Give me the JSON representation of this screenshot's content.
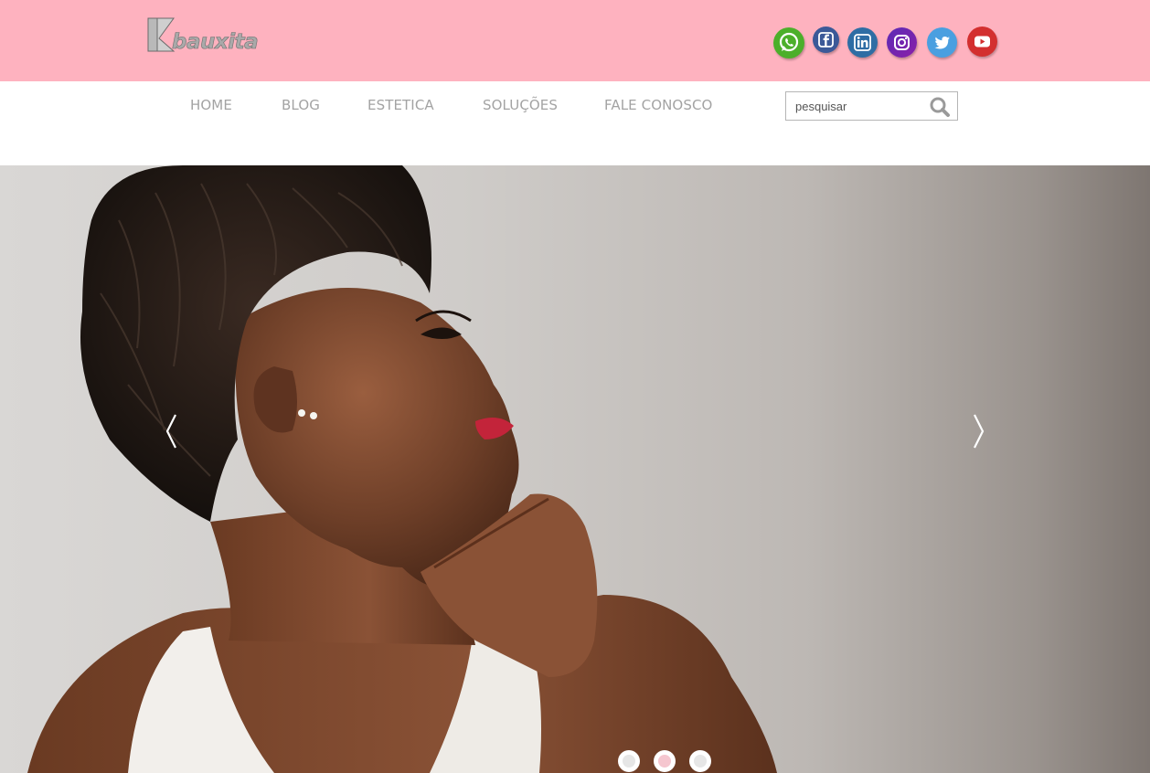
{
  "header": {
    "logo_text": "bauxita",
    "social": [
      {
        "icon": "whatsapp-icon",
        "color": "#4caf2a"
      },
      {
        "icon": "facebook-icon",
        "color": "#3b5998"
      },
      {
        "icon": "linkedin-icon",
        "color": "#2e6da4"
      },
      {
        "icon": "instagram-icon",
        "color": "#7b1fa2"
      },
      {
        "icon": "twitter-icon",
        "color": "#4a9fe0"
      },
      {
        "icon": "youtube-icon",
        "color": "#d32f2f"
      }
    ],
    "background": "#feb2bf"
  },
  "nav": {
    "items": [
      {
        "label": "HOME"
      },
      {
        "label": "BLOG"
      },
      {
        "label": "ESTETICA"
      },
      {
        "label": "SOLUÇÕES"
      },
      {
        "label": "FALE CONOSCO"
      }
    ]
  },
  "search": {
    "placeholder": "pesquisar",
    "icon": "search-icon"
  },
  "slider": {
    "prev_icon": "chevron-left-icon",
    "next_icon": "chevron-right-icon",
    "active_slide": 2,
    "total_slides": 3,
    "dot_colors": [
      "#e6e6e6",
      "#f5c6cf",
      "#e6e6e6"
    ]
  }
}
